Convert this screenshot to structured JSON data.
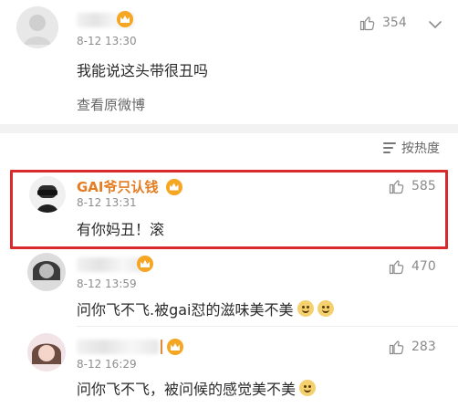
{
  "top_comment": {
    "time": "8-12 13:30",
    "text": "我能说这头带很丑吗",
    "view_original": "查看原微博",
    "likes": "354"
  },
  "sort_bar": {
    "label": "按热度"
  },
  "replies": [
    {
      "name": "GAI爷只认钱",
      "time": "8-12 13:31",
      "text": "有你妈丑！滚",
      "likes": "585"
    },
    {
      "name": "",
      "time": "8-12 13:59",
      "text": "问你飞不飞.被gai怼的滋味美不美",
      "likes": "470"
    },
    {
      "name": "",
      "time": "8-12 16:29",
      "text": "问你飞不飞，被问候的感觉美不美",
      "likes": "283"
    }
  ],
  "colors": {
    "highlight": "#d92b2b",
    "username": "#e47d22"
  }
}
